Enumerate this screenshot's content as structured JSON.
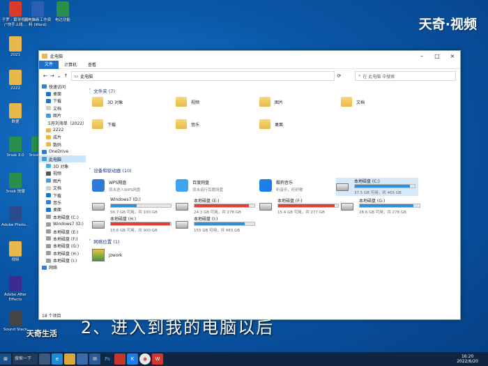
{
  "watermark": "天奇·视频",
  "watermark2": "天奇生活",
  "subtitle": "2、进入到我的电脑以后",
  "desktop_icons": [
    {
      "label": "子罗 - 篇导视频 (\"快手上线…",
      "color": "#d93a2b"
    },
    {
      "label": "此电脑新工作资料 (Word)",
      "color": "#2b5fb3"
    },
    {
      "label": "电达功能",
      "color": "#2a8f4a"
    },
    {
      "label": "2021",
      "color": "#e8b94a"
    },
    {
      "label": "2222",
      "color": "#e8b94a"
    },
    {
      "label": "数据",
      "color": "#e8b94a"
    },
    {
      "label": "3rssk 3.0",
      "color": "#2a8f4a"
    },
    {
      "label": "3rssk 7.0",
      "color": "#2a8f4a"
    },
    {
      "label": "3rssk 快捷",
      "color": "#2a8f4a"
    },
    {
      "label": "Adobe Photo...",
      "color": "#2a4c8f"
    },
    {
      "label": "视频",
      "color": "#e8b94a"
    },
    {
      "label": "Adobe After Effects",
      "color": "#3b2a8f"
    },
    {
      "label": "Sound Stack",
      "color": "#444444"
    }
  ],
  "window": {
    "title": "此电脑",
    "ribbon_tabs": [
      "文件",
      "计算机",
      "查看"
    ],
    "address": "此电脑",
    "search_placeholder": "在 此电脑 中搜索",
    "status": "18 个项目"
  },
  "nav": [
    {
      "label": "快速访问",
      "color": "#3a7bd5",
      "sel": false
    },
    {
      "label": "桌面",
      "color": "#1a73c8",
      "sel": false
    },
    {
      "label": "下载",
      "color": "#1a73c8",
      "sel": false
    },
    {
      "label": "文档",
      "color": "#cccccc",
      "sel": false
    },
    {
      "label": "图片",
      "color": "#4a9ad8",
      "sel": false
    },
    {
      "label": "5月刘海单（2022）",
      "color": "#e8b94a",
      "sel": false
    },
    {
      "label": "2222",
      "color": "#e8b94a",
      "sel": false
    },
    {
      "label": "成片",
      "color": "#e8b94a",
      "sel": false
    },
    {
      "label": "数码",
      "color": "#e8b94a",
      "sel": false
    },
    {
      "label": "OneDrive",
      "color": "#2f7ad8",
      "sel": false
    },
    {
      "label": "此电脑",
      "color": "#4a9ad8",
      "sel": true
    },
    {
      "label": "3D 对象",
      "color": "#4ab0e0",
      "sel": false
    },
    {
      "label": "视频",
      "color": "#555555",
      "sel": false
    },
    {
      "label": "图片",
      "color": "#4a9ad8",
      "sel": false
    },
    {
      "label": "文档",
      "color": "#cccccc",
      "sel": false
    },
    {
      "label": "下载",
      "color": "#1a73c8",
      "sel": false
    },
    {
      "label": "音乐",
      "color": "#3a7bd5",
      "sel": false
    },
    {
      "label": "桌面",
      "color": "#1a73c8",
      "sel": false
    },
    {
      "label": "本地磁盘 (C:)",
      "color": "#999999",
      "sel": false
    },
    {
      "label": "Windows7 (D:)",
      "color": "#999999",
      "sel": false
    },
    {
      "label": "本地磁盘 (E:)",
      "color": "#999999",
      "sel": false
    },
    {
      "label": "本地磁盘 (F:)",
      "color": "#999999",
      "sel": false
    },
    {
      "label": "本地磁盘 (G:)",
      "color": "#999999",
      "sel": false
    },
    {
      "label": "本地磁盘 (H:)",
      "color": "#999999",
      "sel": false
    },
    {
      "label": "本地磁盘 (I:)",
      "color": "#999999",
      "sel": false
    },
    {
      "label": "网络",
      "color": "#3a7bd5",
      "sel": false
    }
  ],
  "sections": {
    "folders": "文件夹 (7)",
    "devices": "设备和驱动器 (10)",
    "network": "网络位置 (1)"
  },
  "folders": [
    "3D 对象",
    "视频",
    "图片",
    "文档",
    "下载",
    "音乐",
    "桌面"
  ],
  "apps": [
    {
      "name": "WPS网盘",
      "desc": "双击进入WPS网盘",
      "color": "#2f7ad8"
    },
    {
      "name": "百度网盘",
      "desc": "双击运行百度网盘",
      "color": "#3ba7f0"
    },
    {
      "name": "酷狗音乐",
      "desc": "听音乐，听好歌",
      "color": "#1a7fe8"
    }
  ],
  "drives": [
    {
      "name": "本地磁盘 (C:)",
      "free": "37.5 GB 可用，共 465 GB",
      "pct": 0.92,
      "color": "#2f8fd8"
    },
    {
      "name": "Windows7 (D:)",
      "free": "56.7 GB 可用，共 100 GB",
      "pct": 0.43,
      "color": "#2f8fd8"
    },
    {
      "name": "本地磁盘 (E:)",
      "free": "24.3 GB 可用，共 278 GB",
      "pct": 0.91,
      "color": "#e0413b"
    },
    {
      "name": "本地磁盘 (F:)",
      "free": "15.4 GB 可用，共 277 GB",
      "pct": 0.94,
      "color": "#e0413b"
    },
    {
      "name": "本地磁盘 (G:)",
      "free": "28.6 GB 可用，共 278 GB",
      "pct": 0.9,
      "color": "#2f8fd8"
    },
    {
      "name": "本地磁盘 (H:)",
      "free": "10.6 GB 可用，共 900 GB",
      "pct": 0.99,
      "color": "#e0413b"
    },
    {
      "name": "本地磁盘 (I:)",
      "free": "155 GB 可用，共 983 GB",
      "pct": 0.84,
      "color": "#2f8fd8"
    }
  ],
  "network_items": [
    {
      "name": "Jzwork"
    }
  ],
  "taskbar": {
    "search": "搜索一下",
    "time": "16:20",
    "date": "2022/6/20"
  }
}
